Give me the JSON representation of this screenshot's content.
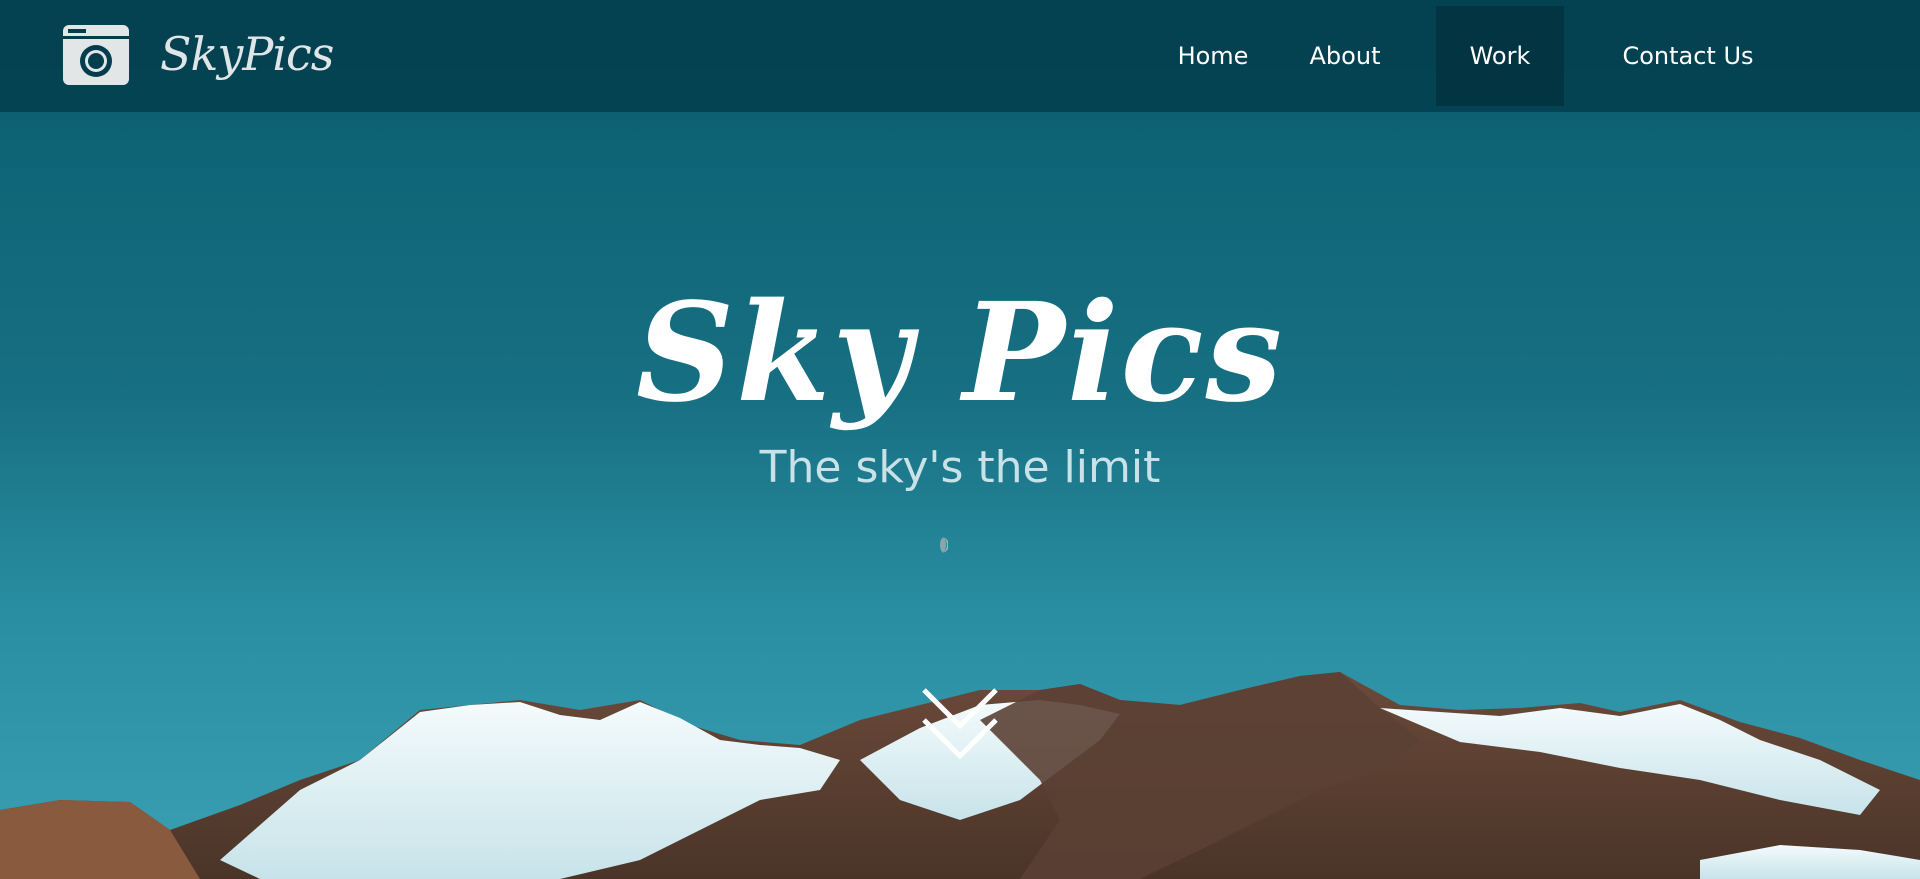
{
  "brand": {
    "logo_icon": "camera-icon",
    "name": "SkyPics"
  },
  "nav": {
    "items": [
      {
        "label": "Home",
        "active": false
      },
      {
        "label": "About",
        "active": false
      },
      {
        "label": "Work",
        "active": true
      },
      {
        "label": "Contact Us",
        "active": false
      }
    ]
  },
  "hero": {
    "title": "Sky Pics",
    "subtitle": "The sky's the limit",
    "scroll_icon": "double-chevron-down-icon"
  },
  "colors": {
    "navbar_bg": "#043e4e",
    "active_nav_bg": "#02303c",
    "sky_top": "#0b5566",
    "sky_bottom": "#3ba0b3",
    "text": "#ffffff",
    "subtitle": "#c9e2e7"
  }
}
